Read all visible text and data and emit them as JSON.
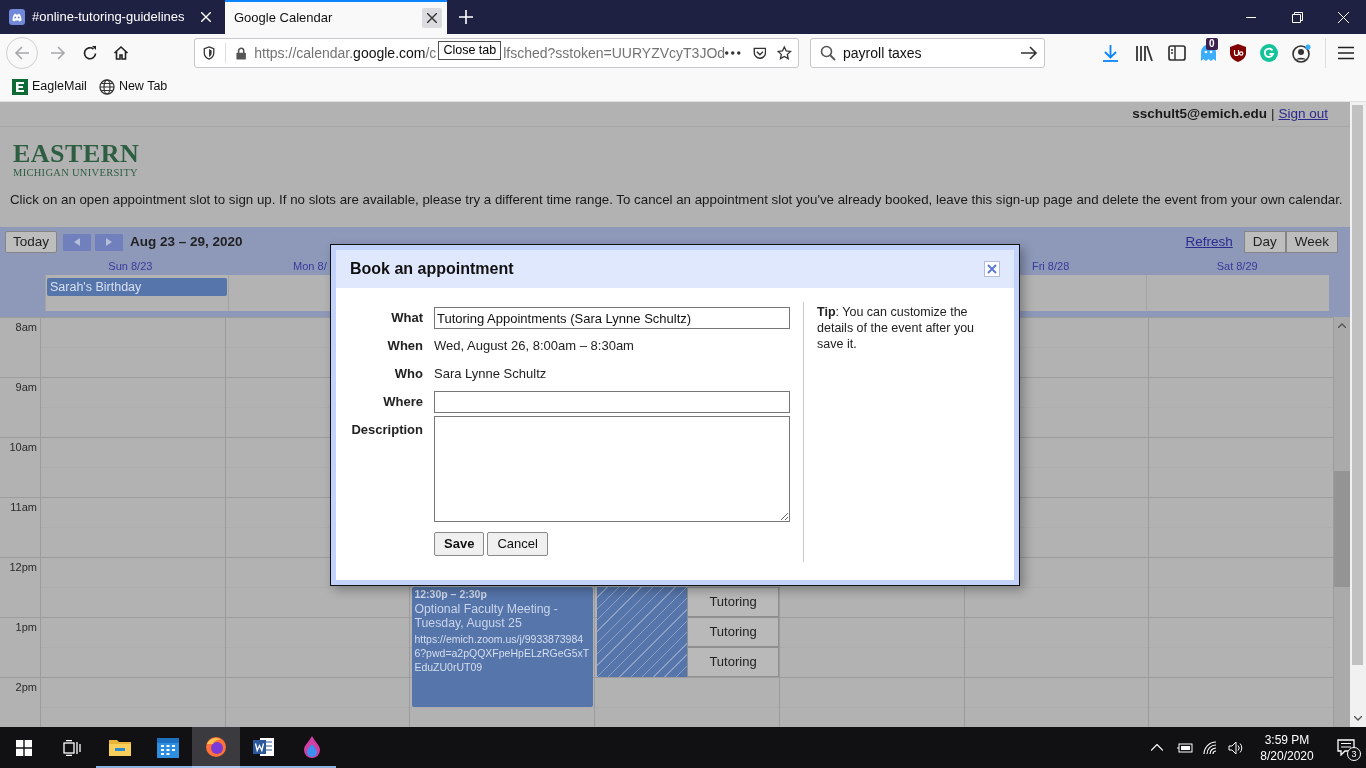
{
  "browser": {
    "tabs": [
      {
        "title": "#online-tutoring-guidelines",
        "selected": false
      },
      {
        "title": "Google Calendar",
        "selected": true
      }
    ],
    "tooltip": "Close tab",
    "url": [
      {
        "text": "https://calendar.",
        "strong": false
      },
      {
        "text": "google.com",
        "strong": true
      },
      {
        "text": "/c",
        "strong": false
      }
    ],
    "url_after_tooltip": "lfsched?sstoken=UURYZVcyT3JOd",
    "search": {
      "value": "payroll taxes"
    },
    "extension_badge": "0",
    "bookmarks": [
      "EagleMail",
      "New Tab"
    ]
  },
  "page": {
    "account": "sschult5@emich.edu",
    "separator": "|",
    "sign_out": "Sign out",
    "logo": {
      "name": "EASTERN",
      "subtitle": "MICHIGAN UNIVERSITY"
    },
    "instructions": "Click on an open appointment slot to sign up. If no slots are available, please try a different time range. To cancel an appointment slot you've already booked, leave this sign-up page and delete the event from your own calendar.",
    "toolbar": {
      "today": "Today",
      "range": "Aug 23 – 29, 2020",
      "refresh": "Refresh",
      "views": [
        "Day",
        "Week"
      ]
    },
    "hours": [
      "8am",
      "9am",
      "10am",
      "11am",
      "12pm",
      "1pm",
      "2pm"
    ],
    "days": [
      {
        "label": "Sun 8/23",
        "all_day": [
          "Sarah's Birthday"
        ]
      },
      {
        "label": "Mon 8/"
      },
      {
        "events": [
          {
            "kind": "meeting",
            "time": "12:30p – 2:30p",
            "title": "Optional Faculty Meeting - Tuesday, August 25",
            "details": "https://emich.zoom.us/j/99338739846?pwd=a2pQQXFpeHpELzRGeG5xTEduZU0rUT09"
          }
        ]
      },
      {
        "events": [
          {
            "kind": "busy"
          },
          {
            "kind": "slot",
            "title": "Tutoring"
          },
          {
            "kind": "slot",
            "title": "Tutoring"
          },
          {
            "kind": "slot",
            "title": "Tutoring"
          }
        ]
      }
    ],
    "days_right": [
      {
        "label": "Fri 8/28"
      },
      {
        "label": "Sat 8/29"
      }
    ]
  },
  "dialog": {
    "title": "Book an appointment",
    "fields": [
      {
        "kind": "input",
        "label": "What",
        "value": "Tutoring Appointments (Sara Lynne Schultz)"
      },
      {
        "kind": "text",
        "label": "When",
        "value": "Wed, August 26, 8:00am – 8:30am"
      },
      {
        "kind": "text",
        "label": "Who",
        "value": "Sara Lynne Schultz"
      },
      {
        "kind": "input",
        "label": "Where"
      },
      {
        "kind": "textarea",
        "label": "Description"
      }
    ],
    "buttons": [
      "Save",
      "Cancel"
    ],
    "tip": "**Tip**: You can customize the details of the event after you save it."
  },
  "taskbar": {
    "time": "3:59 PM",
    "date": "8/20/2020",
    "notifications": "3"
  }
}
